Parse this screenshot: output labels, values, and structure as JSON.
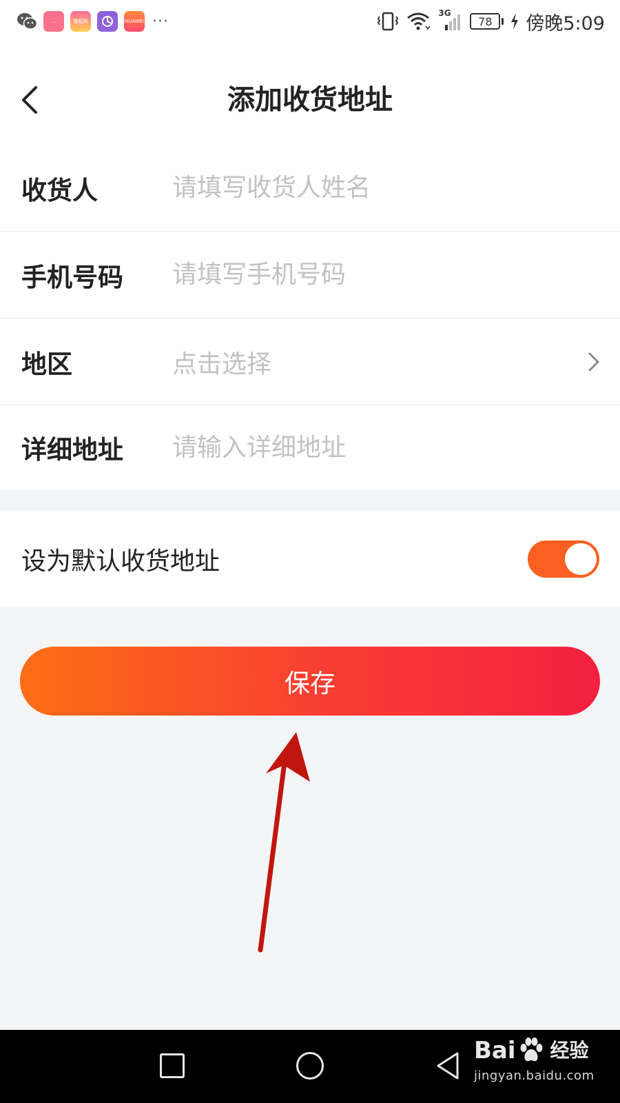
{
  "status_bar": {
    "app_icons": [
      "wechat-icon",
      "app-icon-1",
      "app-icon-2",
      "app-icon-3",
      "app-icon-4"
    ],
    "app_icon_texts": [
      "…",
      "搜狐网",
      "",
      "HUAWEI"
    ],
    "overflow": "···",
    "network": "3G",
    "battery": "78",
    "time": "傍晚5:09",
    "icons": [
      "vibrate-icon",
      "wifi-icon",
      "signal-icon",
      "battery-icon",
      "charging-icon"
    ]
  },
  "header": {
    "title": "添加收货地址",
    "back_icon": "chevron-left-icon"
  },
  "form": {
    "rows": [
      {
        "label": "收货人",
        "placeholder": "请填写收货人姓名"
      },
      {
        "label": "手机号码",
        "placeholder": "请填写手机号码"
      },
      {
        "label": "地区",
        "value": "点击选择"
      },
      {
        "label": "详细地址",
        "placeholder": "请输入详细地址"
      }
    ]
  },
  "default_switch": {
    "label": "设为默认收货地址",
    "on": true
  },
  "save_button": {
    "label": "保存"
  },
  "colors": {
    "accent": "#fb5f22",
    "gradient_start": "#fc6e15",
    "gradient_end": "#f4203f",
    "annotation": "#c0160e",
    "background": "#f4f5f7"
  },
  "watermark": {
    "brand_left": "Bai",
    "brand_right": "经验",
    "url": "jingyan.baidu.com"
  }
}
